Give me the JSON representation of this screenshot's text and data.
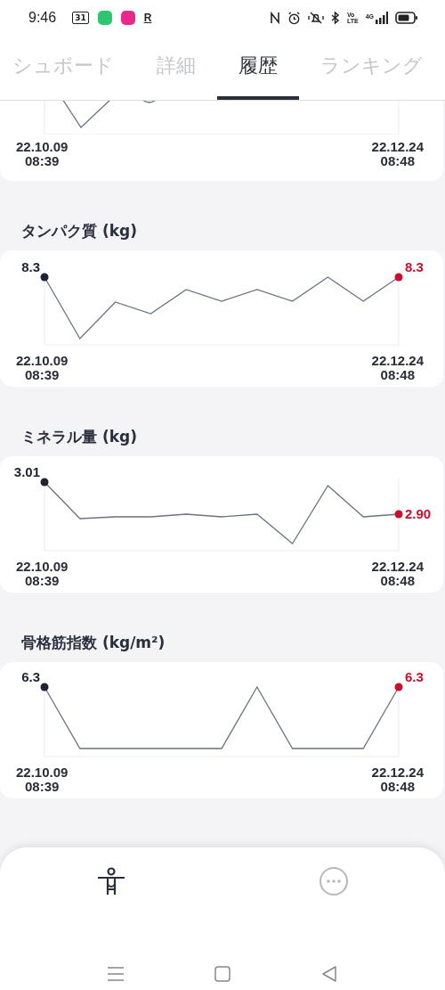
{
  "status_bar": {
    "time": "9:46",
    "calendar_day": "31",
    "letter": "R",
    "volte_top": "Vo",
    "volte_bottom": "LTE",
    "network": "4G"
  },
  "tabs": [
    {
      "label": "シュボード",
      "selected": false
    },
    {
      "label": "詳細",
      "selected": false
    },
    {
      "label": "履歴",
      "selected": true
    },
    {
      "label": "ランキング",
      "selected": false
    }
  ],
  "partial_card": {
    "start_date": "22.10.09",
    "start_time": "08:39",
    "end_date": "22.12.24",
    "end_time": "08:48"
  },
  "charts": [
    {
      "title": "タンパク質 (kg)",
      "first_value": "8.3",
      "last_value": "8.3",
      "start_date": "22.10.09",
      "start_time": "08:39",
      "end_date": "22.12.24",
      "end_time": "08:48"
    },
    {
      "title": "ミネラル量 (kg)",
      "first_value": "3.01",
      "last_value": "2.90",
      "start_date": "22.10.09",
      "start_time": "08:39",
      "end_date": "22.12.24",
      "end_time": "08:48"
    },
    {
      "title": "骨格筋指数 (kg/m²)",
      "first_value": "6.3",
      "last_value": "6.3",
      "start_date": "22.10.09",
      "start_time": "08:39",
      "end_date": "22.12.24",
      "end_time": "08:48"
    }
  ]
}
